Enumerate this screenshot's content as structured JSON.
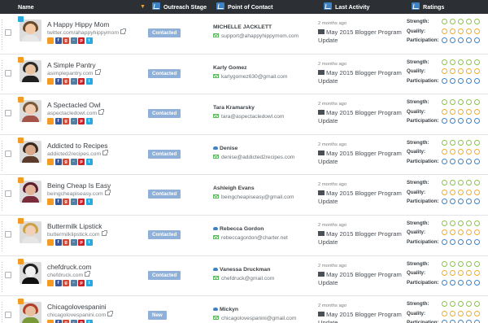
{
  "header": {
    "name": "Name",
    "outreach_stage": "Outreach Stage",
    "point_of_contact": "Point of Contact",
    "last_activity": "Last Activity",
    "ratings": "Ratings"
  },
  "rating_labels": {
    "strength": "Strength:",
    "quality": "Quality:",
    "participation": "Participation:"
  },
  "colors": {
    "strength": "#8bc34a",
    "quality": "#f0ad2e",
    "participation": "#3f82c4",
    "stage_badge": "#8fb0d8",
    "header_bg": "#2c2f33"
  },
  "rows": [
    {
      "name": "A Happy Hippy Mom",
      "url": "twitter.com/ahappyhippymom",
      "badge": "twitter",
      "stage": "Contacted",
      "contact_name": "MICHELLE JACKLETT",
      "contact_email": "support@ahappyhippymom.com",
      "activity_ago": "2 months ago",
      "activity_line1": "May 2015 Blogger Program",
      "activity_line2": "Update"
    },
    {
      "name": "A Simple Pantry",
      "url": "asimplepantry.com",
      "badge": "rss",
      "stage": "Contacted",
      "contact_name": "Karly Gomez",
      "contact_email": "karlygomez630@gmail.com",
      "activity_ago": "2 months ago",
      "activity_line1": "May 2015 Blogger Program",
      "activity_line2": "Update"
    },
    {
      "name": "A Spectacled Owl",
      "url": "aspectacledowl.com",
      "badge": "rss",
      "stage": "Contacted",
      "contact_name": "Tara Kramarsky",
      "contact_email": "tara@aspectacledowl.com",
      "activity_ago": "2 months ago",
      "activity_line1": "May 2015 Blogger Program",
      "activity_line2": "Update"
    },
    {
      "name": "Addicted to Recipes",
      "url": "addicted2recipes.com",
      "badge": "rss",
      "stage": "Contacted",
      "contact_name": "Denise",
      "contact_email": "denise@addicted2recipes.com",
      "activity_ago": "2 months ago",
      "activity_line1": "May 2015 Blogger Program",
      "activity_line2": "Update"
    },
    {
      "name": "Being Cheap Is Easy",
      "url": "beingcheapiseasy.com",
      "badge": "rss",
      "stage": "Contacted",
      "contact_name": "Ashleigh Evans",
      "contact_email": "beingcheapiseasy@gmail.com",
      "activity_ago": "2 months ago",
      "activity_line1": "May 2015 Blogger Program",
      "activity_line2": "Update"
    },
    {
      "name": "Buttermilk Lipstick",
      "url": "buttermilklipstick.com",
      "badge": "rss",
      "stage": "Contacted",
      "contact_name": "Rebecca Gordon",
      "contact_email": "rebeccagordon@charter.net",
      "activity_ago": "2 months ago",
      "activity_line1": "May 2015 Blogger Program",
      "activity_line2": "Update"
    },
    {
      "name": "chefdruck.com",
      "url": "chefdruck.com",
      "badge": "rss",
      "stage": "Contacted",
      "contact_name": "Vanessa Druckman",
      "contact_email": "chefdruck@gmail.com",
      "activity_ago": "2 months ago",
      "activity_line1": "May 2015 Blogger Program",
      "activity_line2": "Update"
    },
    {
      "name": "Chicagolovespanini",
      "url": "chicagolovespanini.com",
      "badge": "rss",
      "stage": "New",
      "contact_name": "Mickyn",
      "contact_email": "chicagolovespanini@gmail.com",
      "activity_ago": "2 months ago",
      "activity_line1": "May 2015 Blogger Program",
      "activity_line2": "Update"
    }
  ]
}
